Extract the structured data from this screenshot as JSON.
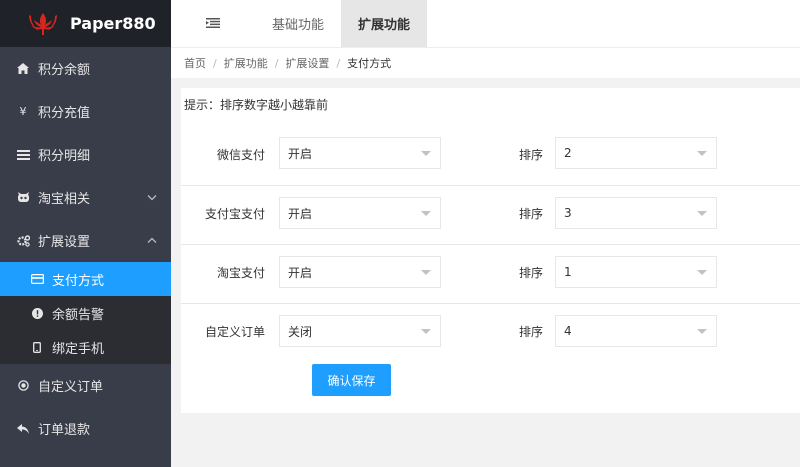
{
  "logo": {
    "text": "Paper880"
  },
  "sidebar": {
    "items": [
      {
        "label": "积分余额",
        "icon": "home-icon"
      },
      {
        "label": "积分充值",
        "icon": "yen-icon"
      },
      {
        "label": "积分明细",
        "icon": "list-icon"
      },
      {
        "label": "淘宝相关",
        "icon": "taobao-icon"
      },
      {
        "label": "扩展设置",
        "icon": "gears-icon"
      }
    ],
    "subitems": [
      {
        "label": "支付方式",
        "icon": "credit-card-icon"
      },
      {
        "label": "余额告警",
        "icon": "alert-icon"
      },
      {
        "label": "绑定手机",
        "icon": "mobile-icon"
      }
    ],
    "bottom_items": [
      {
        "label": "自定义订单",
        "icon": "target-icon"
      },
      {
        "label": "订单退款",
        "icon": "reply-icon"
      }
    ]
  },
  "topbar": {
    "tabs": [
      {
        "label": "基础功能"
      },
      {
        "label": "扩展功能"
      }
    ]
  },
  "breadcrumb": [
    "首页",
    "扩展功能",
    "扩展设置",
    "支付方式"
  ],
  "main": {
    "tip": "提示：排序数字越小越靠前",
    "rows": [
      {
        "label": "微信支付",
        "status": "开启",
        "sort_label": "排序",
        "sort": "2"
      },
      {
        "label": "支付宝支付",
        "status": "开启",
        "sort_label": "排序",
        "sort": "3"
      },
      {
        "label": "淘宝支付",
        "status": "开启",
        "sort_label": "排序",
        "sort": "1"
      },
      {
        "label": "自定义订单",
        "status": "关闭",
        "sort_label": "排序",
        "sort": "4"
      }
    ],
    "save_label": "确认保存"
  },
  "colors": {
    "accent": "#1e9fff",
    "sidebar_bg": "#393d49",
    "logo_bg": "#20222a",
    "logo_red": "#d7261e"
  }
}
